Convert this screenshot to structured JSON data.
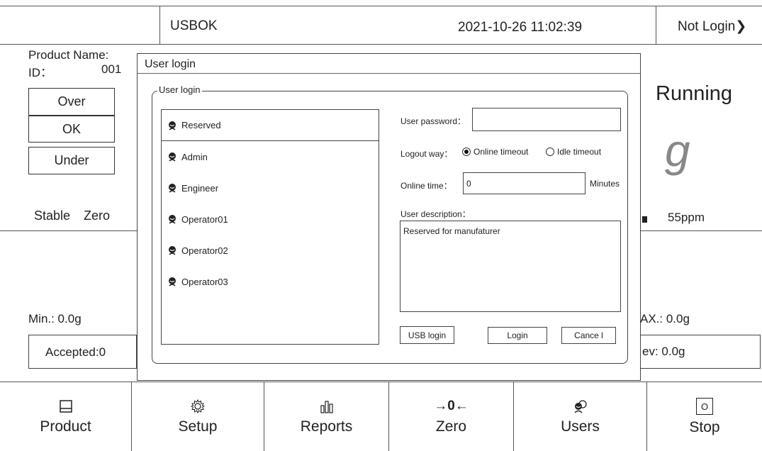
{
  "header": {
    "app_name": "USBOK",
    "datetime": "2021-10-26 11:02:39",
    "login_status": "Not Login",
    "login_chevron": "❯"
  },
  "product": {
    "name_label": "Product Name:",
    "id_label": "ID：",
    "id_value": "001"
  },
  "status_boxes": [
    "Over",
    "OK",
    "Under"
  ],
  "indicators": {
    "stable": "Stable",
    "zero": "Zero",
    "speed": "55ppm"
  },
  "run_state": "Running",
  "unit": "g",
  "stats": {
    "min": "Min.: 0.0g",
    "max_partial": "AX.: 0.0g",
    "accepted": "Accepted:0",
    "dev_partial": "ev: 0.0g"
  },
  "dialog": {
    "title": "User login",
    "group_title": "User login",
    "users": [
      "Reserved",
      "Admin",
      "Engineer",
      "Operator01",
      "Operator02",
      "Operator03"
    ],
    "selected_user": "Reserved",
    "password_label": "User password：",
    "password_value": "",
    "logout_way_label": "Logout way：",
    "logout_options": [
      "Online timeout",
      "Idle timeout"
    ],
    "logout_selected": "Online timeout",
    "online_time_label": "Online time：",
    "online_time_value": "0",
    "minutes_label": "Minutes",
    "description_label": "User description：",
    "description_value": "Reserved for manufaturer",
    "usb_login_label": "USB login",
    "login_label": "Login",
    "cancel_label": "Cance l"
  },
  "nav": {
    "product": "Product",
    "setup": "Setup",
    "reports": "Reports",
    "zero": "Zero",
    "zero_glyph": "→0←",
    "users": "Users",
    "stop": "Stop",
    "stop_glyph": "O"
  },
  "icons": {
    "product": "product-tray-icon",
    "setup": "gear-icon",
    "reports": "bar-chart-icon",
    "zero": "zero-arrows-icon",
    "users": "users-icon",
    "stop": "stop-icon",
    "user_item": "user-avatar-icon"
  }
}
